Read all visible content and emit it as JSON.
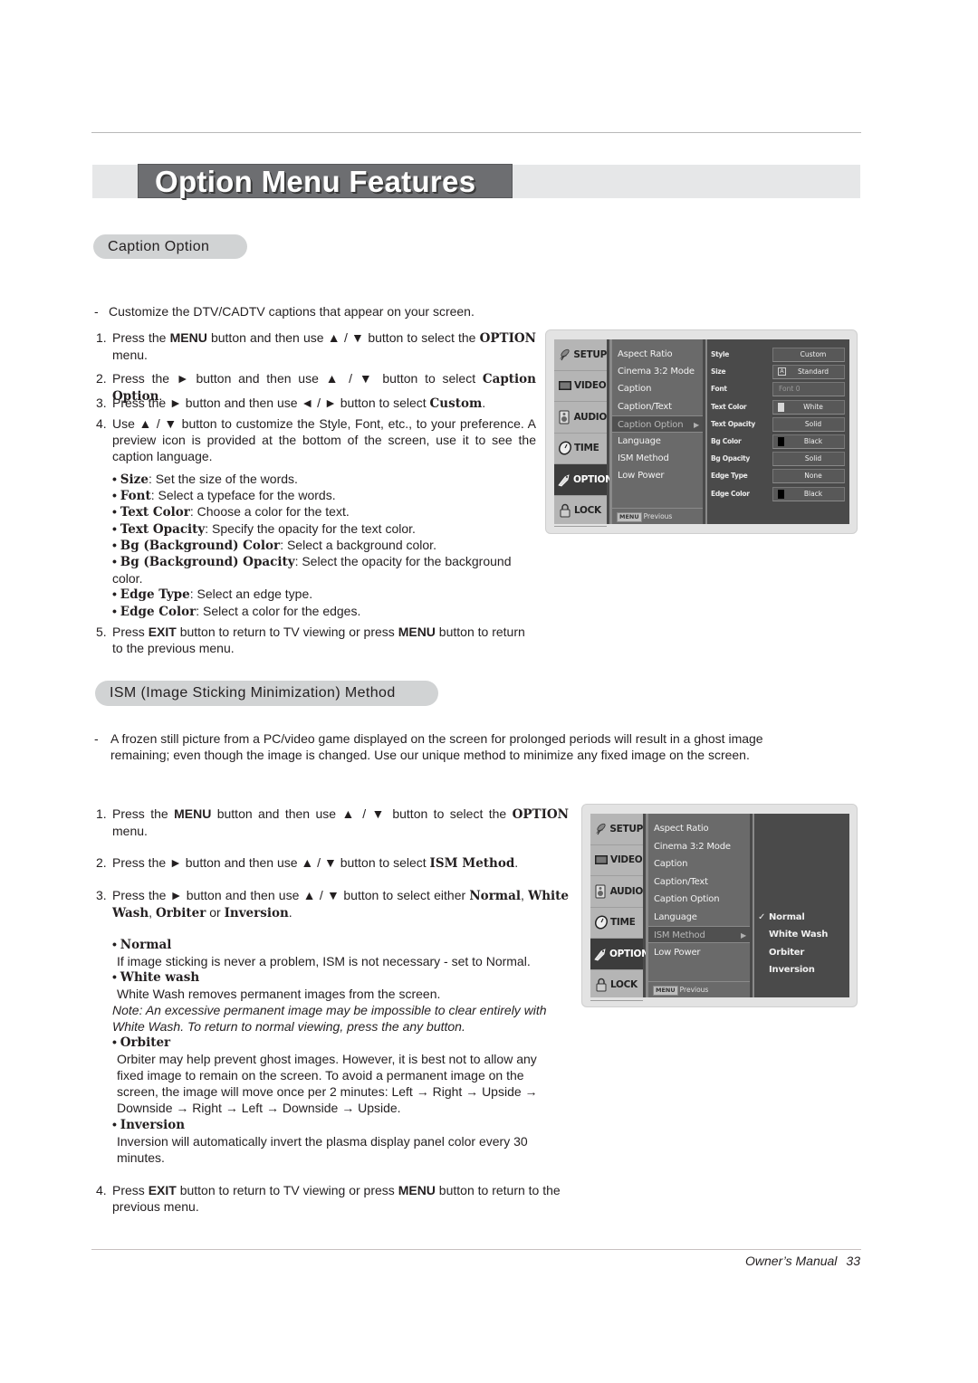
{
  "page": {
    "title": "Option Menu Features",
    "footer_label": "Owner’s Manual",
    "page_number": "33"
  },
  "caption_option": {
    "heading": "Caption Option",
    "intro": "Customize the DTV/CADTV captions that appear on your screen.",
    "steps": [
      {
        "num": "1.",
        "parts": [
          "Press the ",
          {
            "b": "MENU"
          },
          " button and then use ▲ / ▼ button to select the ",
          {
            "bs": "OPTION"
          },
          " menu."
        ]
      },
      {
        "num": "2.",
        "parts": [
          "Press the ► button and then use ▲ / ▼ button to select ",
          {
            "bs": "Caption Option"
          },
          "."
        ]
      },
      {
        "num": "3.",
        "parts": [
          "Press the ► button and then use ◄ / ► button to select ",
          {
            "bs": "Custom"
          },
          "."
        ]
      },
      {
        "num": "4.",
        "parts": [
          "Use ▲ / ▼ button to customize the Style, Font, etc., to your preference. A preview icon is provided at the bottom of the screen, use it to see the caption language."
        ]
      },
      {
        "num": "5.",
        "parts": [
          "Press ",
          {
            "b": "EXIT"
          },
          " button to return to TV viewing or press ",
          {
            "b": "MENU"
          },
          " button to return to the previous menu."
        ]
      }
    ],
    "bullets": [
      {
        "term": "Size",
        "desc": ": Set the size of the words."
      },
      {
        "term": "Font",
        "desc": ": Select a typeface for the words."
      },
      {
        "term": "Text Color",
        "desc": ": Choose a color for the text."
      },
      {
        "term": "Text Opacity",
        "desc": ": Specify the opacity for the text color."
      },
      {
        "term": "Bg (Background) Color",
        "desc": ": Select a background color."
      },
      {
        "term": "Bg (Background) Opacity",
        "desc": ": Select the opacity for the background color."
      },
      {
        "term": "Edge Type",
        "desc": ": Select an edge type."
      },
      {
        "term": "Edge Color",
        "desc": ": Select a color for the edges."
      }
    ]
  },
  "ism": {
    "heading": "ISM (Image Sticking Minimization) Method",
    "intro": "A frozen still picture from a PC/video game displayed on the screen for prolonged periods will result in a ghost image remaining; even though the image is changed. Use our unique method to minimize any fixed image on the screen.",
    "steps": [
      {
        "num": "1.",
        "parts": [
          "Press the ",
          {
            "b": "MENU"
          },
          " button and then use ▲ / ▼  button to select the ",
          {
            "bs": "OPTION"
          },
          " menu."
        ]
      },
      {
        "num": "2.",
        "parts": [
          "Press the ► button and then use ▲ / ▼ button to select ",
          {
            "bs": "ISM Method"
          },
          "."
        ]
      },
      {
        "num": "3.",
        "parts": [
          "Press the ► button and then use ▲ / ▼ button to select either ",
          {
            "bs": "Normal"
          },
          ", ",
          {
            "bs": "White Wash"
          },
          ", ",
          {
            "bs": "Orbiter"
          },
          " or ",
          {
            "bs": "Inversion"
          },
          "."
        ]
      },
      {
        "num": "4.",
        "parts": [
          "Press ",
          {
            "b": "EXIT"
          },
          " button to return to TV viewing or press ",
          {
            "b": "MENU"
          },
          " button to return to the previous menu."
        ]
      }
    ],
    "options": [
      {
        "term": "Normal",
        "desc": "If image sticking is never a problem, ISM is not necessary - set to Normal."
      },
      {
        "term": "White wash",
        "desc": "White Wash removes permanent images from the screen.",
        "note": "Note: An excessive permanent image may be impossible to clear entirely with White Wash. To return to normal viewing, press the any button."
      },
      {
        "term": "Orbiter",
        "desc": "Orbiter may help prevent ghost images. However, it is best not to allow any fixed image to remain on the screen. To avoid a permanent image on the screen, the image will move once per 2 minutes: Left → Right → Upside → Downside → Right → Left → Downside → Upside."
      },
      {
        "term": "Inversion",
        "desc": "Inversion will automatically invert the plasma display panel color every 30 minutes."
      }
    ]
  },
  "tv_menu": {
    "tabs": [
      {
        "label": "SETUP",
        "icon": "satellite-icon"
      },
      {
        "label": "VIDEO",
        "icon": "monitor-icon"
      },
      {
        "label": "AUDIO",
        "icon": "speaker-icon"
      },
      {
        "label": "TIME",
        "icon": "clock-icon"
      },
      {
        "label": "OPTION",
        "icon": "tag-icon",
        "active": true
      },
      {
        "label": "LOCK",
        "icon": "lock-icon"
      }
    ],
    "items": [
      "Aspect Ratio",
      "Cinema 3:2 Mode",
      "Caption",
      "Caption/Text",
      "Caption Option",
      "Language",
      "ISM Method",
      "Low Power"
    ],
    "menu_key": "MENU",
    "previous_label": "Previous",
    "caption_settings": [
      {
        "label": "Style",
        "value": "Custom"
      },
      {
        "label": "Size",
        "value": "Standard",
        "icon": "A"
      },
      {
        "label": "Font",
        "value": "Font 0",
        "dim": true
      },
      {
        "label": "Text Color",
        "value": "White",
        "swatch": "#d8d8d8"
      },
      {
        "label": "Text Opacity",
        "value": "Solid"
      },
      {
        "label": "Bg Color",
        "value": "Black",
        "swatch": "#000000"
      },
      {
        "label": "Bg Opacity",
        "value": "Solid"
      },
      {
        "label": "Edge Type",
        "value": "None"
      },
      {
        "label": "Edge Color",
        "value": "Black",
        "swatch": "#000000"
      }
    ],
    "ism_options": [
      {
        "label": "Normal",
        "checked": true
      },
      {
        "label": "White Wash"
      },
      {
        "label": "Orbiter"
      },
      {
        "label": "Inversion"
      }
    ]
  }
}
